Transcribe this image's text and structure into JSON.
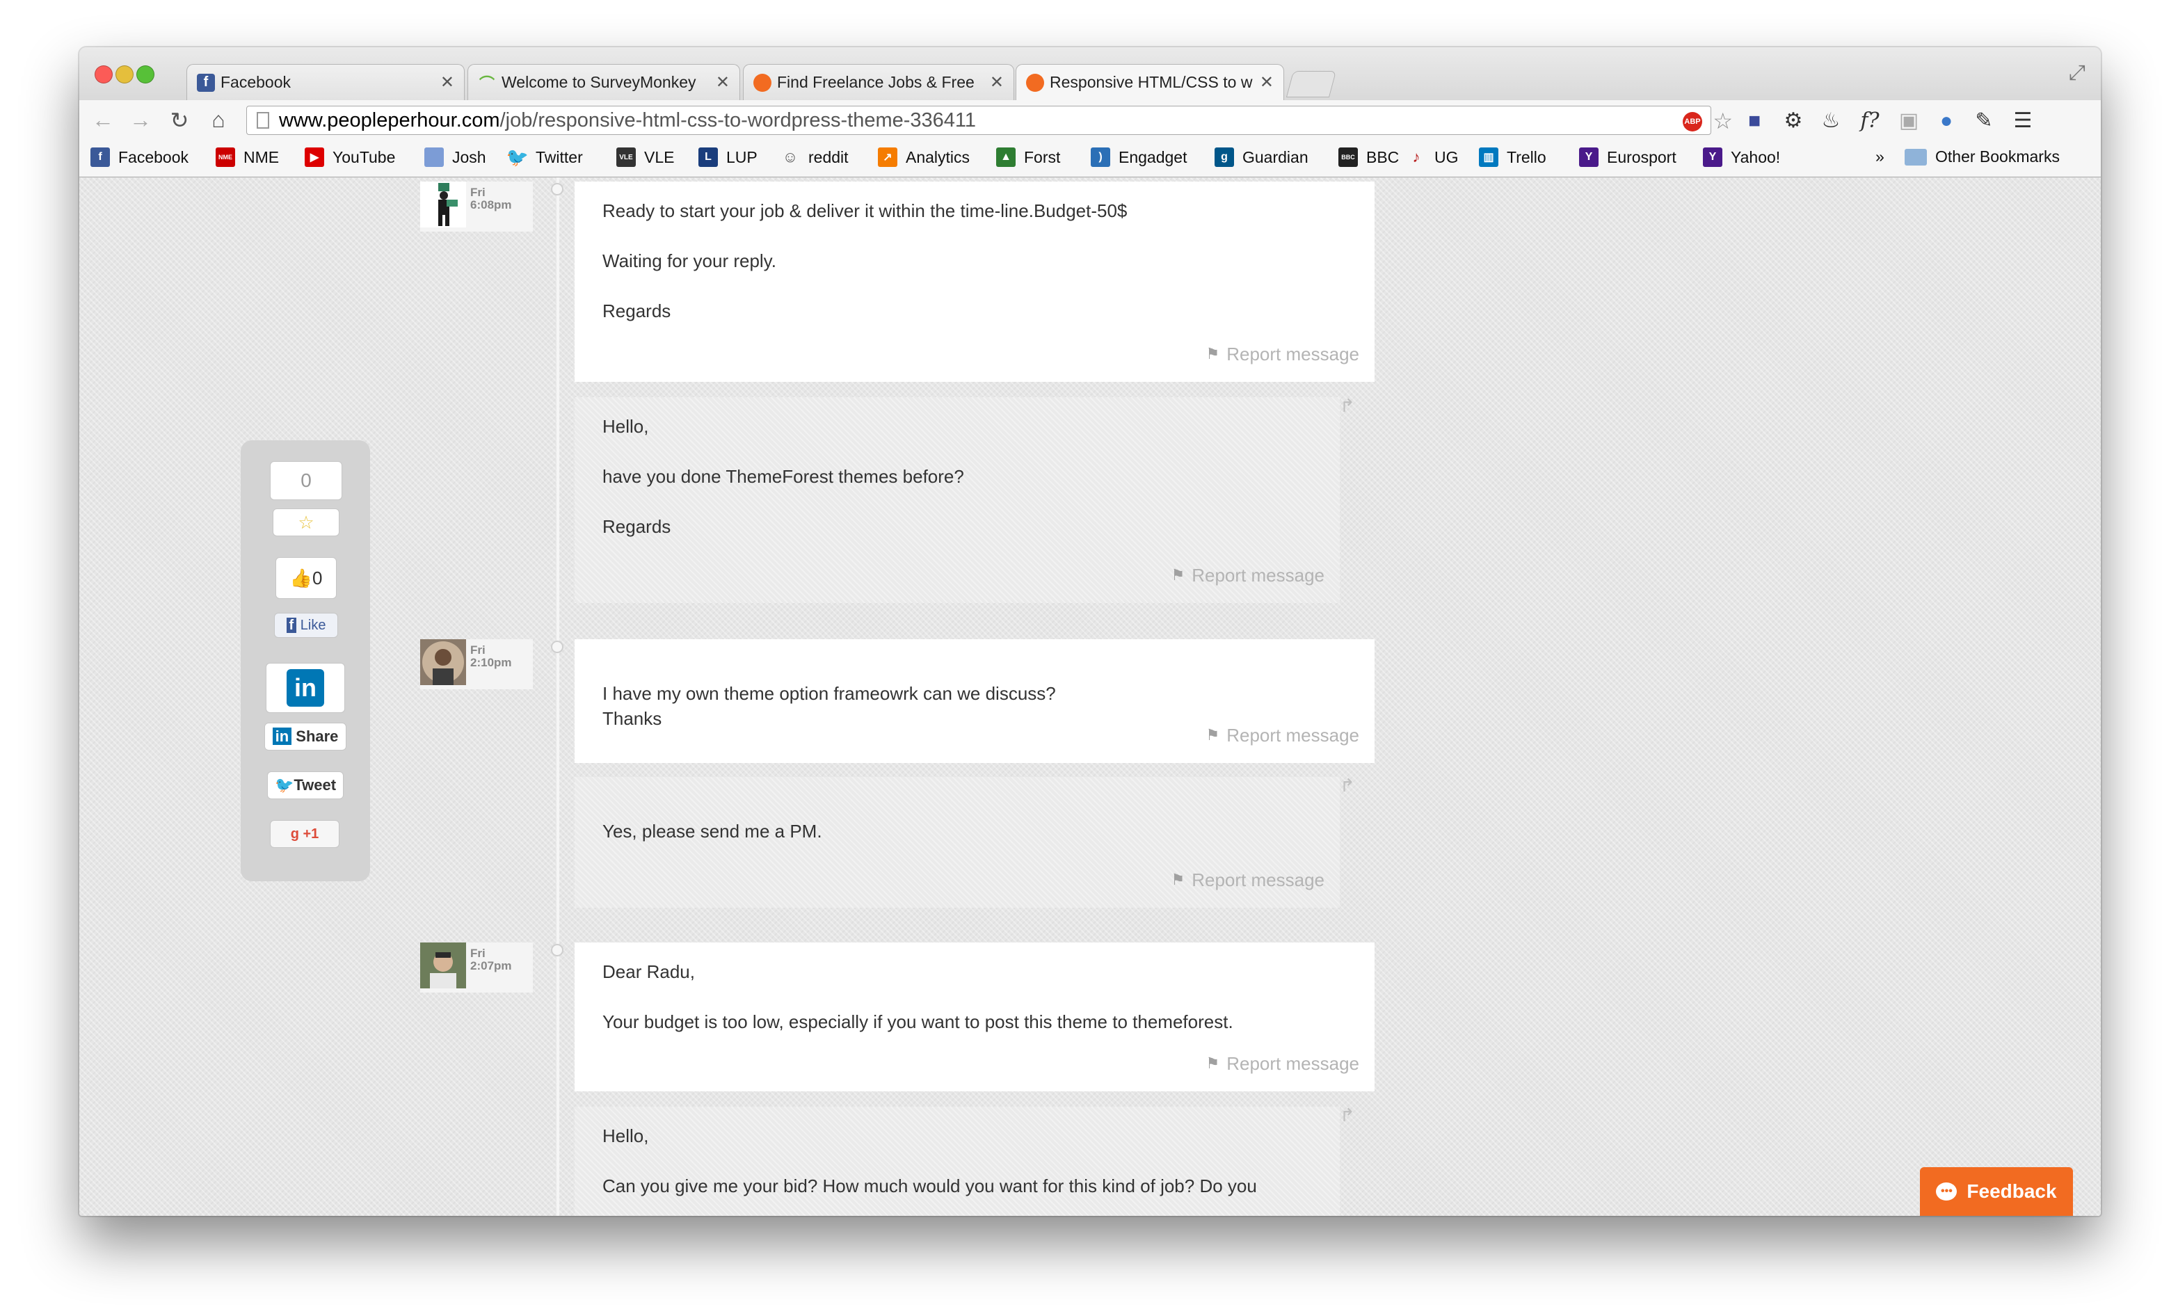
{
  "tabs": [
    {
      "title": "Facebook",
      "favicon": "facebook-icon"
    },
    {
      "title": "Welcome to SurveyMonkey",
      "favicon": "surveymonkey-icon"
    },
    {
      "title": "Find Freelance Jobs & Free",
      "favicon": "peopleperhour-icon"
    },
    {
      "title": "Responsive HTML/CSS to w",
      "favicon": "peopleperhour-icon"
    }
  ],
  "address": {
    "host": "www.peopleperhour.com",
    "path": "/job/responsive-html-css-to-wordpress-theme-336411"
  },
  "bookmarks": [
    "Facebook",
    "NME",
    "YouTube",
    "Josh",
    "Twitter",
    "VLE",
    "LUP",
    "reddit",
    "Analytics",
    "Forst",
    "Engadget",
    "Guardian",
    "BBC",
    "UG",
    "Trello",
    "Eurosport",
    "Yahoo!"
  ],
  "bookmarks_more": "»",
  "other_bookmarks": "Other Bookmarks",
  "share": {
    "rating_count": "0",
    "like_count": "0",
    "fb_like_label": "Like",
    "linkedin_share_label": "Share",
    "tweet_label": "Tweet",
    "gplus_label": "+1"
  },
  "messages": [
    {
      "paragraphs": [
        "Ready to start your job & deliver it within the time-line.Budget-50$",
        "Waiting for your reply.",
        "Regards"
      ],
      "report": "Report message",
      "day": "Fri",
      "time": "6:08pm"
    },
    {
      "paragraphs": [
        "Hello,",
        "have you done ThemeForest themes before?",
        "Regards"
      ],
      "report": "Report message"
    },
    {
      "paragraphs": [
        "I have my own theme option frameowrk can we discuss?\nThanks"
      ],
      "report": "Report message",
      "day": "Fri",
      "time": "2:10pm"
    },
    {
      "paragraphs": [
        "Yes, please send me a PM."
      ],
      "report": "Report message"
    },
    {
      "paragraphs": [
        "Dear Radu,",
        "Your budget is too low, especially if you want to post this theme to themeforest."
      ],
      "report": "Report message",
      "day": "Fri",
      "time": "2:07pm"
    },
    {
      "paragraphs": [
        "Hello,",
        "Can you give me your bid? How much would you want for this kind of job? Do you"
      ]
    }
  ],
  "feedback_label": "Feedback",
  "colors": {
    "accent": "#f26b21",
    "report": "#b4b4b4",
    "facebook": "#3b5998",
    "linkedin": "#0077b5",
    "twitter": "#1da1f2"
  }
}
